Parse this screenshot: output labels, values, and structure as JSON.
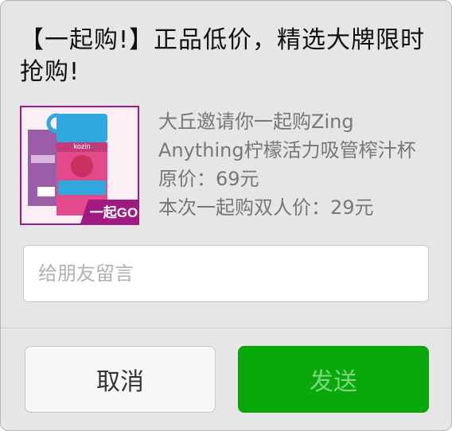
{
  "dialog": {
    "title": "【一起购!】正品低价，精选大牌限时抢购!"
  },
  "product": {
    "image_icon": "product-thumbnail",
    "image_badge": "一起GO",
    "brand_label": "kozin",
    "line1": "大丘邀请你一起购Zing",
    "line2": "Anything柠檬活力吸管榨汁杯",
    "original_price": "原价：69元",
    "group_price": "本次一起购双人价：29元"
  },
  "message": {
    "placeholder": "给朋友留言",
    "value": ""
  },
  "buttons": {
    "cancel_label": "取消",
    "send_label": "发送"
  },
  "colors": {
    "send_bg": "#09a90c",
    "send_text_disabled": "#7bd67d",
    "thumb_border": "#a01a82"
  }
}
